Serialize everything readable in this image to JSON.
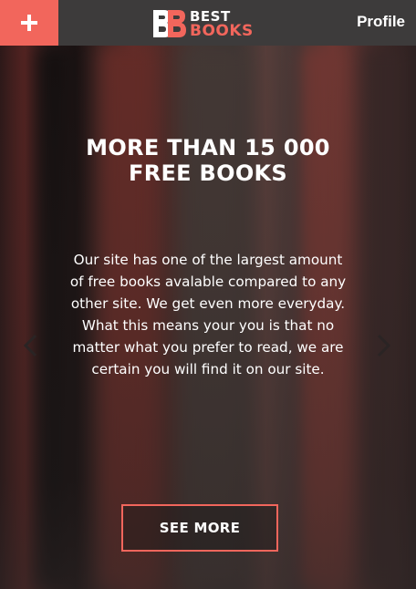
{
  "header": {
    "add_icon": "plus-icon",
    "logo": {
      "mark_icon": "double-b-logo-mark",
      "line1": "BEST",
      "line2": "BOOKS"
    },
    "profile_label": "Profile"
  },
  "hero": {
    "headline": [
      "MORE THAN 15 000",
      "FREE BOOKS"
    ],
    "description": [
      "Our site has one of the largest amount",
      "of free books avalable compared to any",
      "other site. We get even more everyday.",
      "What this means your you is that no",
      "matter what you prefer to read, we are",
      "certain you will find it on our site."
    ],
    "prev_icon": "chevron-left-icon",
    "next_icon": "chevron-right-icon",
    "cta_label": "SEE MORE"
  },
  "colors": {
    "accent": "#f2665c",
    "header_bg": "#3d3b3b",
    "text": "#ffffff"
  }
}
